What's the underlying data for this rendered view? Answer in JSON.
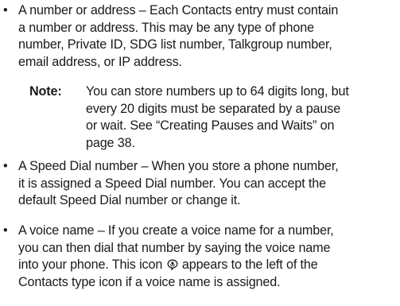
{
  "bullets": [
    {
      "symbol": "•",
      "lines": [
        "A number or address – Each Contacts entry must contain",
        "a number or address. This may be any type of phone",
        "number, Private ID, SDG list number, Talkgroup number,",
        "email address, or IP address."
      ]
    },
    {
      "symbol": "•",
      "lines": [
        "A Speed Dial number – When you store a phone number,",
        "it is assigned a Speed Dial number. You can accept the",
        "default Speed Dial number or change it."
      ]
    },
    {
      "symbol": "•",
      "lines": [
        "A voice name – If you create a voice name for a number,",
        "you can then dial that number by saying the voice name",
        "into your phone. This icon ",
        "Contacts type icon if a voice name is assigned."
      ],
      "line3_after_icon": " appears to the left of the",
      "icon": "voice-name-icon"
    }
  ],
  "note": {
    "label": "Note:",
    "lines": [
      "You can store numbers up to 64 digits long, but",
      "every 20 digits must be separated by a pause",
      "or wait. See “Creating Pauses and Waits” on",
      "page 38."
    ]
  }
}
